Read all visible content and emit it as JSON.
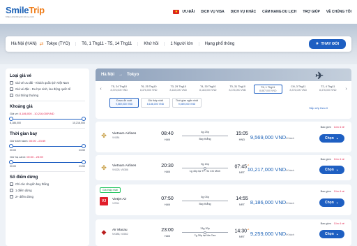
{
  "brand": {
    "name_main": "Smile",
    "name_accent": "Trip",
    "tagline": "Khám phá thế giới với nụ cười"
  },
  "nav": {
    "flag": "★",
    "items": [
      "ƯU ĐÃI",
      "DỊCH VỤ VISA",
      "DỊCH VỤ KHÁC",
      "CẨM NANG DU LỊCH",
      "TRỢ GIÚP",
      "VỀ CHÚNG TÔI"
    ]
  },
  "search": {
    "from": "Hà Nội (HAN)",
    "swap_icon": "⇄",
    "to": "Tokyo (TYO)",
    "dates": "T6, 1 Thg11 - T5, 14 Thg11",
    "trip_type": "Khứ hồi",
    "passengers": "1 Người lớn",
    "cabin": "Hạng phổ thông",
    "button": "THAY ĐỔI",
    "button_icon": "✈"
  },
  "filters": {
    "fare_type": {
      "title": "Loại giá vé",
      "options": [
        "Giá vé ưu đãi - Khách quốc tịch Việt Nam",
        "Giá vé đặc - Du học sinh, lao động quốc tế",
        "Giá thông thường"
      ]
    },
    "price": {
      "title": "Khoảng giá",
      "label": "Giá vé: ",
      "value": "8,186,000 - 10,216,000VND",
      "min": "8,186,000",
      "max": "10,216,000"
    },
    "time": {
      "title": "Thời gian bay",
      "depart_label": "Giờ khởi hành: ",
      "depart_value": "00:00 - 23:59",
      "depart_min": "00:00",
      "depart_max": "23:59",
      "arrive_label": "Giờ hạ cánh: ",
      "arrive_value": "00:00 - 23:59",
      "arrive_min": "00:00",
      "arrive_max": "23:59"
    },
    "stops": {
      "title": "Số điểm dừng",
      "options": [
        "Chỉ các chuyến bay thẳng",
        "1 điểm dừng",
        "2+ điểm dừng"
      ]
    }
  },
  "route": {
    "from": "Hà Nội",
    "arrow": "→",
    "to": "Tokyo",
    "plane_icon": "✈"
  },
  "date_strip": {
    "prev": "‹",
    "next": "›",
    "days": [
      {
        "date": "T5, 24 Thg10",
        "price": "8,376,000 VND"
      },
      {
        "date": "T6, 25 Thg10",
        "price": "8,376,000 VND"
      },
      {
        "date": "T3, 29 Thg10",
        "price": "8,183,000 VND"
      },
      {
        "date": "T4, 30 Thg10",
        "price": "8,183,000 VND"
      },
      {
        "date": "T5, 31 Thg10",
        "price": "8,376,000 VND"
      },
      {
        "date": "T6, 1 Thg11",
        "price": "8,887,000 VND"
      },
      {
        "date": "CN, 3 Thg11",
        "price": "8,376,000 VND"
      },
      {
        "date": "T2, 4 Thg11",
        "price": "8,376,000 VND"
      }
    ],
    "active_index": 5
  },
  "sort": {
    "boxes": [
      {
        "title": "Được đề xuất",
        "value": "9,569,000 VND"
      },
      {
        "title": "Giá thấp nhất",
        "value": "8,186,000 VND"
      },
      {
        "title": "Thời gian ngắn nhất",
        "value": "9,569,000 VND"
      }
    ],
    "meta": "Sắp xếp theo ▾"
  },
  "flights": [
    {
      "airline": "Vietnam Airlines",
      "code": "VN384",
      "logo": "✤",
      "dep": "08:40",
      "dep_ap": "HAN",
      "arr": "15:05",
      "arr_ap": "HND",
      "arr_plus": "",
      "dur": "4g 25p",
      "info": "Bay thẳng",
      "price": "9,569,000 VND",
      "unit": "/Khách",
      "included": "Bao gồm",
      "remaining": "Còn 4 vé",
      "choose": "Chọn",
      "badge": ""
    },
    {
      "airline": "Vietnam Airlines",
      "code": "VN325, VN386",
      "logo": "✤",
      "dep": "20:30",
      "dep_ap": "HAN",
      "arr": "07:45",
      "arr_ap": "NRT",
      "arr_plus": "+1",
      "dur": "9g 15p",
      "info": "1g 40p tại TP Hồ Chí Minh",
      "price": "10,217,000 VND",
      "unit": "/Khách",
      "included": "Bao gồm",
      "remaining": "Còn 4 vé",
      "choose": "Chọn",
      "badge": ""
    },
    {
      "airline": "Vietjet Air",
      "code": "VJ934",
      "logo": "VJ",
      "dep": "07:50",
      "dep_ap": "HAN",
      "arr": "14:55",
      "arr_ap": "NRT",
      "arr_plus": "",
      "dur": "5g 05p",
      "info": "Bay thẳng",
      "price": "8,186,000 VND",
      "unit": "/Khách",
      "included": "Bao gồm",
      "remaining": "Còn 4 vé",
      "choose": "Chọn",
      "badge": "Giá thấp nhất"
    },
    {
      "airline": "Air Macau",
      "code": "NX888, NX862",
      "logo": "◆",
      "dep": "23:00",
      "dep_ap": "HAN",
      "arr": "14:30",
      "arr_ap": "NRT",
      "arr_plus": "+1",
      "dur": "13g 30p",
      "info": "7g 30p tại Ma Cao",
      "price": "9,259,000 VND",
      "unit": "/Khách",
      "included": "Bao gồm",
      "remaining": "Còn 4 vé",
      "choose": "Chọn",
      "badge": ""
    }
  ],
  "colors": {
    "primary": "#1e5fc2",
    "accent": "#ef7d1a",
    "alert": "#e11d48"
  }
}
